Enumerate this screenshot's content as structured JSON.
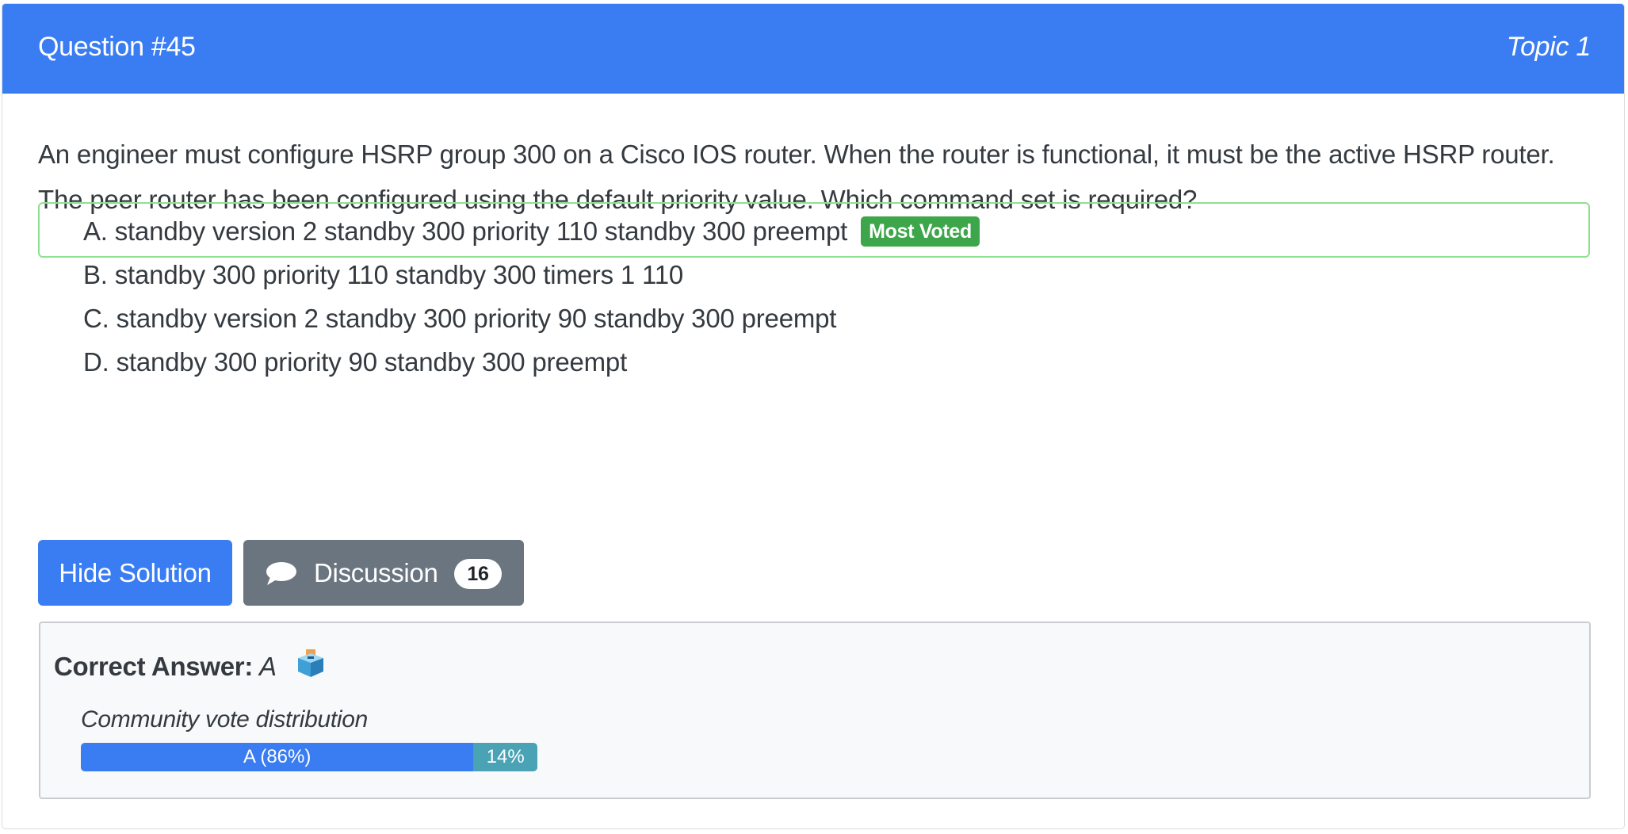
{
  "header": {
    "question_number": "Question #45",
    "topic": "Topic 1"
  },
  "question": {
    "text": "An engineer must configure HSRP group 300 on a Cisco IOS router. When the router is functional, it must be the active HSRP router. The peer router has been configured using the default priority value. Which command set is required?"
  },
  "choices": [
    {
      "letter": "A.",
      "text": "standby version 2 standby 300 priority 110 standby 300 preempt",
      "badge": "Most Voted"
    },
    {
      "letter": "B.",
      "text": "standby 300 priority 110 standby 300 timers 1 110"
    },
    {
      "letter": "C.",
      "text": "standby version 2 standby 300 priority 90 standby 300 preempt"
    },
    {
      "letter": "D.",
      "text": "standby 300 priority 90 standby 300 preempt"
    }
  ],
  "actions": {
    "hide_solution_label": "Hide Solution",
    "discussion_label": "Discussion",
    "discussion_count": "16",
    "discussion_icon": "chat-bubble-icon"
  },
  "answer": {
    "label": "Correct Answer:",
    "value": "A",
    "icon": "ballot-box-icon",
    "vote_title": "Community vote distribution",
    "votes": [
      {
        "label": "A (86%)",
        "percent": 86,
        "color": "#3a7df2"
      },
      {
        "label": "14%",
        "percent": 14,
        "color": "#4aa3b5"
      }
    ]
  },
  "colors": {
    "header_bg": "#3a7df2",
    "most_voted_badge": "#3da54a",
    "voted_border": "#8fe08f",
    "discussion_button": "#6b757f"
  }
}
